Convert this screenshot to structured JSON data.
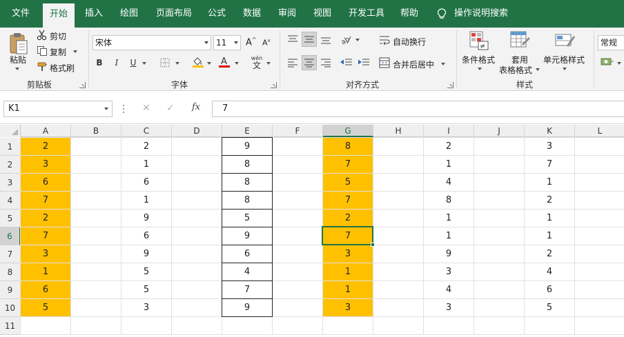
{
  "tabs": [
    "文件",
    "开始",
    "插入",
    "绘图",
    "页面布局",
    "公式",
    "数据",
    "审阅",
    "视图",
    "开发工具",
    "帮助",
    "操作说明搜索"
  ],
  "active_tab_index": 1,
  "ribbon": {
    "clipboard": {
      "label": "剪贴板",
      "paste": "粘贴",
      "cut": "剪切",
      "copy": "复制",
      "format_painter": "格式刷"
    },
    "font": {
      "label": "字体",
      "font_name": "宋体",
      "font_size": "11",
      "bold": "B",
      "italic": "I",
      "underline": "U",
      "grow": "A",
      "shrink": "A",
      "phonetic": "wén",
      "phonetic_char": "文"
    },
    "alignment": {
      "label": "对齐方式",
      "wrap_text": "自动换行",
      "merge_center": "合并后居中"
    },
    "styles": {
      "label": "样式",
      "conditional_format": "条件格式",
      "table_format_1": "套用",
      "table_format_2": "表格格式",
      "cell_styles": "单元格样式"
    },
    "number": {
      "format": "常规"
    }
  },
  "formula_bar": {
    "name_box": "K1",
    "fx": "fx",
    "value": "7"
  },
  "colors": {
    "accent": "#217346",
    "highlight": "#ffc000"
  },
  "columns": [
    "A",
    "B",
    "C",
    "D",
    "E",
    "F",
    "G",
    "H",
    "I",
    "J",
    "K",
    "L"
  ],
  "selected_column": "G",
  "rows": [
    "1",
    "2",
    "3",
    "4",
    "5",
    "6",
    "7",
    "8",
    "9",
    "10",
    "11"
  ],
  "selected_row": "6",
  "cells": {
    "A": [
      "2",
      "3",
      "6",
      "7",
      "2",
      "7",
      "3",
      "1",
      "6",
      "5"
    ],
    "C": [
      "2",
      "1",
      "6",
      "1",
      "9",
      "6",
      "9",
      "5",
      "5",
      "3"
    ],
    "E": [
      "9",
      "8",
      "8",
      "8",
      "5",
      "9",
      "6",
      "4",
      "7",
      "9"
    ],
    "G": [
      "8",
      "7",
      "5",
      "7",
      "2",
      "7",
      "3",
      "1",
      "1",
      "3"
    ],
    "I": [
      "2",
      "1",
      "4",
      "8",
      "1",
      "1",
      "9",
      "3",
      "4",
      "3"
    ],
    "K": [
      "3",
      "7",
      "1",
      "2",
      "1",
      "1",
      "2",
      "4",
      "6",
      "5"
    ]
  }
}
